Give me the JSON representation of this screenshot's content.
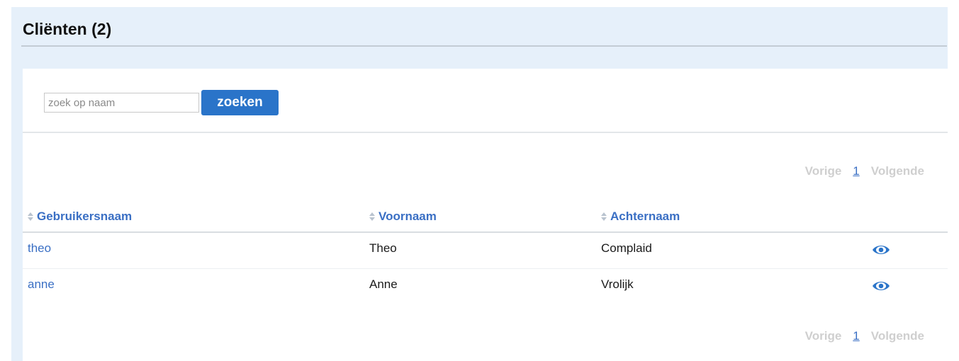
{
  "header": {
    "title": "Cliënten (2)"
  },
  "search": {
    "placeholder": "zoek op naam",
    "value": "",
    "button_label": "zoeken"
  },
  "pager": {
    "prev_label": "Vorige",
    "current_page": "1",
    "next_label": "Volgende"
  },
  "table": {
    "columns": [
      "Gebruikersnaam",
      "Voornaam",
      "Achternaam"
    ],
    "rows": [
      {
        "username": "theo",
        "first_name": "Theo",
        "last_name": "Complaid",
        "action_icon": "eye-icon"
      },
      {
        "username": "anne",
        "first_name": "Anne",
        "last_name": "Vrolijk",
        "action_icon": "eye-icon"
      }
    ]
  },
  "colors": {
    "panel_background": "#e6f0fa",
    "accent_blue": "#2a74c9",
    "link_blue": "#3a6fc4",
    "disabled_gray": "#cfcfcf"
  }
}
